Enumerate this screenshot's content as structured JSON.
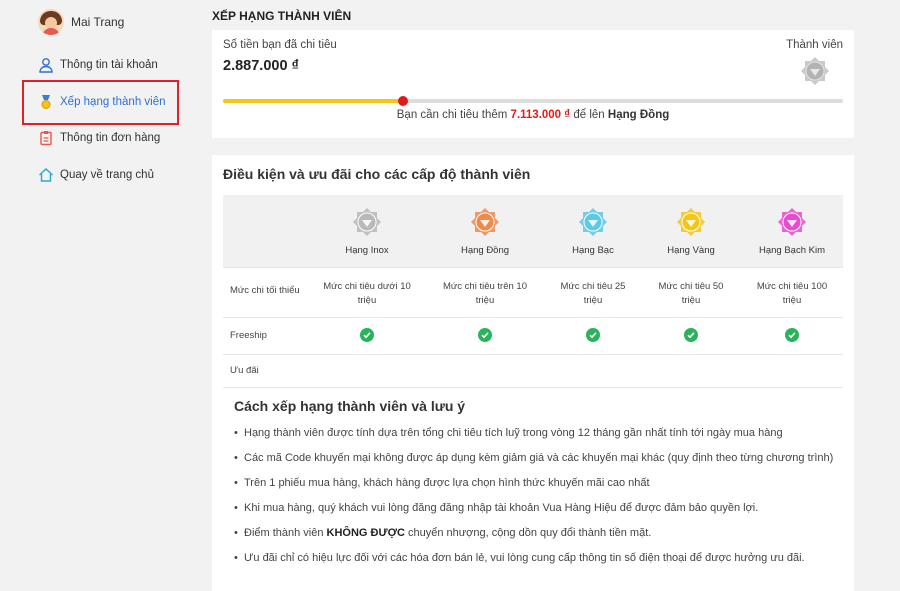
{
  "user": {
    "name": "Mai Trang"
  },
  "sidebar": {
    "items": [
      {
        "label": "Thông tin tài khoản",
        "icon": "user-icon"
      },
      {
        "label": "Xếp hạng thành viên",
        "icon": "medal-icon",
        "active": true
      },
      {
        "label": "Thông tin đơn hàng",
        "icon": "clipboard-icon"
      },
      {
        "label": "Quay về trang chủ",
        "icon": "home-icon"
      }
    ]
  },
  "main": {
    "title": "XẾP HẠNG THÀNH VIÊN",
    "spent": {
      "label": "Số tiền bạn đã chi tiêu",
      "value": "2.887.000 ₫",
      "tier_label": "Thành viên",
      "progress_fraction": 0.29,
      "msg_prefix": "Bạn cần chi tiêu thêm",
      "msg_amount": "7.113.000 ₫",
      "msg_middle": "để lên",
      "msg_rank": "Hạng Đồng"
    },
    "tiers": {
      "title": "Điều kiện và ưu đãi cho các cấp độ thành viên",
      "names": [
        "Hạng Inox",
        "Hạng Đồng",
        "Hạng Bạc",
        "Hạng Vàng",
        "Hạng Bạch Kim"
      ],
      "colors": [
        "#b9b9b9",
        "#f08a4b",
        "#5ec8e8",
        "#f5c518",
        "#e94bd0"
      ],
      "row_min_label": "Mức chi tối thiểu",
      "row_min": [
        [
          "Mức chi tiêu dưới 10",
          "triệu"
        ],
        [
          "Mức chi tiêu trên 10",
          "triệu"
        ],
        [
          "Mức chi tiêu 25",
          "triệu"
        ],
        [
          "Mức chi tiêu 50",
          "triệu"
        ],
        [
          "Mức chi tiêu 100",
          "triệu"
        ]
      ],
      "row_freeship_label": "Freeship",
      "row_uudai_label": "Ưu đãi"
    },
    "rules": {
      "title": "Cách xếp hạng thành viên và lưu ý",
      "items": [
        "Hạng thành viên được tính dựa trên tổng chi tiêu tích luỹ trong vòng 12 tháng gần nhất tính tới ngày mua hàng",
        "Các mã Code khuyến mại không được áp dụng kèm giảm giá và các khuyến mại khác (quy định theo từng chương trình)",
        "Trên 1 phiếu mua hàng, khách hàng được lựa chọn hình thức khuyến mãi cao nhất",
        "Khi mua hàng, quý khách vui lòng đăng đăng nhập tài khoản Vua Hàng Hiệu để được đảm bảo quyền lợi.",
        "Điểm thành viên KHÔNG ĐƯỢC chuyển nhượng, cộng dồn quy đổi thành tiền mặt.",
        "Ưu đãi chỉ có hiệu lực đối với các hóa đơn bán lẻ, vui lòng cung cấp thông tin số điện thoại để được hưởng ưu đãi."
      ]
    }
  }
}
